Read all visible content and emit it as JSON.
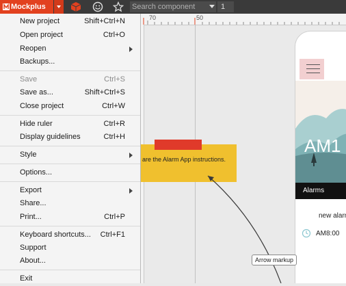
{
  "toolbar": {
    "app_name": "Mockplus",
    "search_placeholder": "Search component",
    "page_number": "1",
    "icons": [
      "mockplus-logo-icon",
      "package-icon",
      "smiley-icon",
      "star-icon"
    ]
  },
  "ruler": {
    "labels": [
      "70",
      "50"
    ]
  },
  "menu": {
    "items": [
      {
        "label": "New project",
        "shortcut": "Shift+Ctrl+N"
      },
      {
        "label": "Open project",
        "shortcut": "Ctrl+O"
      },
      {
        "label": "Reopen",
        "shortcut": "",
        "submenu": true
      },
      {
        "label": "Backups...",
        "shortcut": ""
      },
      {
        "label": "Save",
        "shortcut": "Ctrl+S",
        "disabled": true
      },
      {
        "label": "Save as...",
        "shortcut": "Shift+Ctrl+S"
      },
      {
        "label": "Close project",
        "shortcut": "Ctrl+W"
      },
      {
        "label": "Hide ruler",
        "shortcut": "Ctrl+R"
      },
      {
        "label": "Display guidelines",
        "shortcut": "Ctrl+H"
      },
      {
        "label": "Style",
        "shortcut": "",
        "submenu": true
      },
      {
        "label": "Options...",
        "shortcut": ""
      },
      {
        "label": "Export",
        "shortcut": "",
        "submenu": true
      },
      {
        "label": "Share...",
        "shortcut": ""
      },
      {
        "label": "Print...",
        "shortcut": "Ctrl+P"
      },
      {
        "label": "Keyboard shortcuts...",
        "shortcut": "Ctrl+F1"
      },
      {
        "label": "Support",
        "shortcut": ""
      },
      {
        "label": "About...",
        "shortcut": ""
      },
      {
        "label": "Exit",
        "shortcut": ""
      }
    ]
  },
  "canvas": {
    "sticky_note_text": "are the Alarm App instructions.",
    "arrow_label": "Arrow markup"
  },
  "phone": {
    "time_display": "AM1",
    "alarms_header": "Alarms",
    "new_alarm": "new alarm",
    "alarm_time": "AM8:00"
  },
  "colors": {
    "brand": "#e2411f",
    "toolbar": "#3a3a3a",
    "sticky_note": "#f0c02e",
    "sticky_tab": "#e03a2a"
  }
}
